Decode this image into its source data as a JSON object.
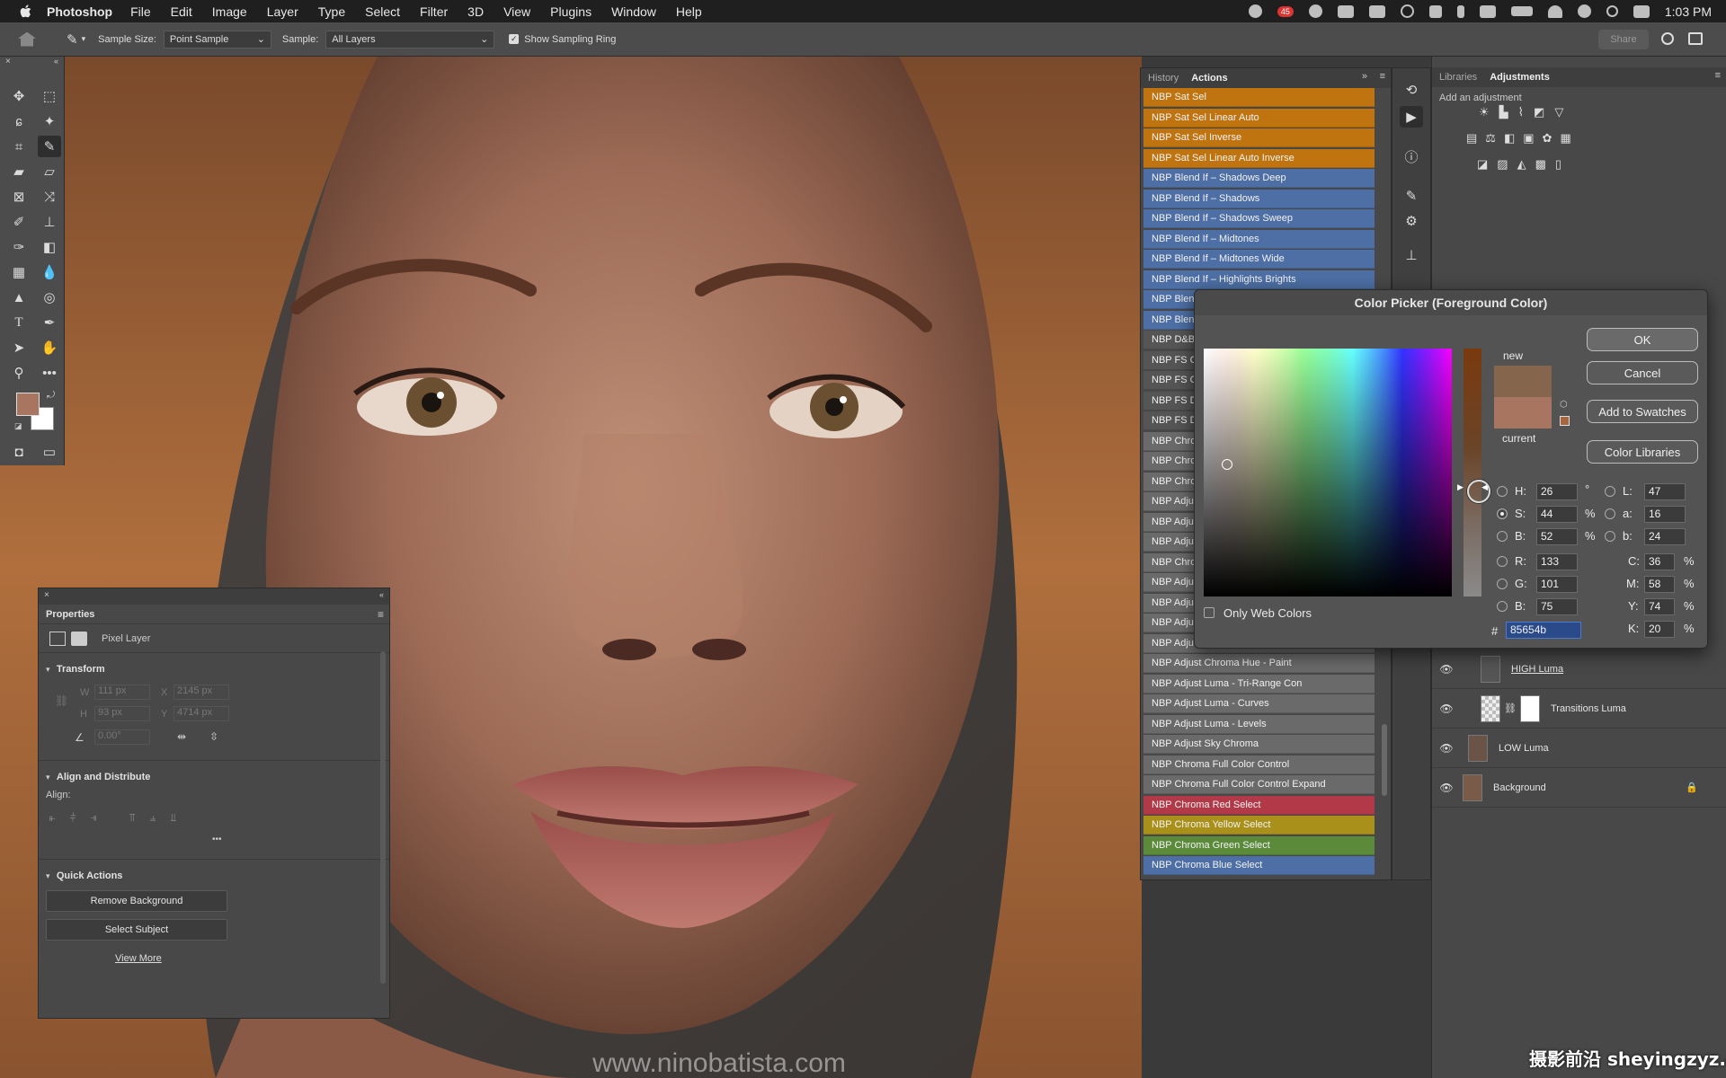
{
  "menubar": {
    "app": "Photoshop",
    "items": [
      "File",
      "Edit",
      "Image",
      "Layer",
      "Type",
      "Select",
      "Filter",
      "3D",
      "View",
      "Plugins",
      "Window",
      "Help"
    ],
    "badge": "45",
    "time": "1:03 PM"
  },
  "options": {
    "sample_size_label": "Sample Size:",
    "sample_size_value": "Point Sample",
    "sample_label": "Sample:",
    "sample_value": "All Layers",
    "ring_label": "Show Sampling Ring",
    "share": "Share"
  },
  "properties": {
    "title": "Properties",
    "kind": "Pixel Layer",
    "transform": "Transform",
    "w_label": "W",
    "w_value": "111 px",
    "x_label": "X",
    "x_value": "2145 px",
    "h_label": "H",
    "h_value": "93 px",
    "y_label": "Y",
    "y_value": "4714 px",
    "angle_value": "0.00°",
    "align_title": "Align and Distribute",
    "align_label": "Align:",
    "more": "•••",
    "quick_title": "Quick Actions",
    "remove_bg": "Remove Background",
    "select_subject": "Select Subject",
    "view_more": "View More"
  },
  "actions_panel": {
    "tab_history": "History",
    "tab_actions": "Actions",
    "items": [
      {
        "label": "NBP Sat Sel",
        "color": "#c07410"
      },
      {
        "label": "NBP Sat Sel Linear Auto",
        "color": "#c07410"
      },
      {
        "label": "NBP Sat Sel Inverse",
        "color": "#c07410"
      },
      {
        "label": "NBP Sat Sel Linear Auto Inverse",
        "color": "#c07410"
      },
      {
        "label": "NBP Blend If – Shadows Deep",
        "color": "#4d6fa5"
      },
      {
        "label": "NBP Blend If – Shadows",
        "color": "#4d6fa5"
      },
      {
        "label": "NBP Blend If – Shadows Sweep",
        "color": "#4d6fa5"
      },
      {
        "label": "NBP Blend If – Midtones",
        "color": "#4d6fa5"
      },
      {
        "label": "NBP Blend If – Midtones Wide",
        "color": "#4d6fa5"
      },
      {
        "label": "NBP Blend If – Highlights Brights",
        "color": "#4d6fa5"
      },
      {
        "label": "NBP Blend If – Highlights",
        "color": "#4d6fa5"
      },
      {
        "label": "NBP Blend If – Highlights Wide",
        "color": "#4d6fa5"
      },
      {
        "label": "NBP D&B",
        "color": "#555555"
      },
      {
        "label": "NBP FS C",
        "color": "#555555"
      },
      {
        "label": "NBP FS C",
        "color": "#555555"
      },
      {
        "label": "NBP FS D",
        "color": "#555555"
      },
      {
        "label": "NBP FS D",
        "color": "#555555"
      },
      {
        "label": "NBP Chro",
        "color": "#6a6a6a"
      },
      {
        "label": "NBP Chro",
        "color": "#6a6a6a"
      },
      {
        "label": "NBP Chro",
        "color": "#6a6a6a"
      },
      {
        "label": "NBP Adju",
        "color": "#6a6a6a"
      },
      {
        "label": "NBP Adju",
        "color": "#6a6a6a"
      },
      {
        "label": "NBP Adju",
        "color": "#6a6a6a"
      },
      {
        "label": "NBP Chro",
        "color": "#6a6a6a"
      },
      {
        "label": "NBP Adju",
        "color": "#6a6a6a"
      },
      {
        "label": "NBP Adju",
        "color": "#6a6a6a"
      },
      {
        "label": "NBP Adju",
        "color": "#6a6a6a"
      },
      {
        "label": "NBP Adju",
        "color": "#6a6a6a"
      },
      {
        "label": "NBP Adjust Chroma Hue - Paint",
        "color": "#6a6a6a"
      },
      {
        "label": "NBP Adjust Luma - Tri-Range Con",
        "color": "#6a6a6a"
      },
      {
        "label": "NBP Adjust Luma - Curves",
        "color": "#6a6a6a"
      },
      {
        "label": "NBP Adjust Luma - Levels",
        "color": "#6a6a6a"
      },
      {
        "label": "NBP Adjust Sky Chroma",
        "color": "#6a6a6a"
      },
      {
        "label": "NBP Chroma Full Color Control",
        "color": "#6a6a6a"
      },
      {
        "label": "NBP Chroma Full Color Control Expand",
        "color": "#6a6a6a"
      },
      {
        "label": "NBP Chroma Red Select",
        "color": "#b23a48"
      },
      {
        "label": "NBP Chroma Yellow Select",
        "color": "#a8901a"
      },
      {
        "label": "NBP Chroma Green Select",
        "color": "#5a8a3a"
      },
      {
        "label": "NBP Chroma Blue Select",
        "color": "#4d6fa5"
      }
    ]
  },
  "right": {
    "tab_libraries": "Libraries",
    "tab_adjustments": "Adjustments",
    "add_adjustment": "Add an adjustment"
  },
  "layers": [
    {
      "name": "HIGH Luma"
    },
    {
      "name": "Transitions Luma"
    },
    {
      "name": "LOW Luma"
    },
    {
      "name": "Background"
    }
  ],
  "picker": {
    "title": "Color Picker (Foreground Color)",
    "ok": "OK",
    "cancel": "Cancel",
    "add_swatches": "Add to Swatches",
    "color_libraries": "Color Libraries",
    "new": "new",
    "current": "current",
    "web_only": "Only Web Colors",
    "H": "26",
    "S": "44",
    "B": "52",
    "R": "133",
    "G": "101",
    "B2": "75",
    "L": "47",
    "a": "16",
    "b": "24",
    "C": "36",
    "M": "58",
    "Y": "74",
    "K": "20",
    "hex": "85654b",
    "hex_label": "#",
    "deg": "°",
    "pct": "%",
    "new_color": "#85654b",
    "current_color": "#a87560",
    "hue_color": "#ff7a00"
  },
  "watermark": "www.ninobatista.com",
  "corner_watermark": "摄影前沿 sheyingzyz.com",
  "colors": {
    "foreground": "#a87560",
    "background": "#ffffff"
  }
}
